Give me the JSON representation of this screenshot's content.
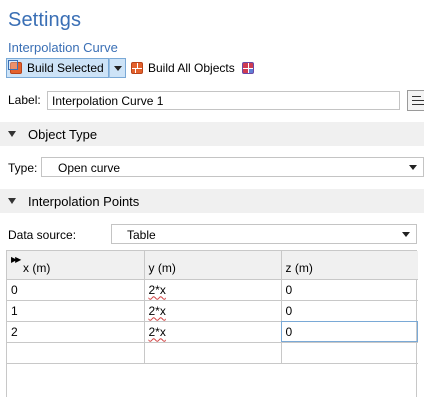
{
  "settings": {
    "title": "Settings",
    "subtitle": "Interpolation Curve"
  },
  "toolbar": {
    "build_selected_label": "Build Selected",
    "build_all_label": "Build All Objects"
  },
  "label_field": {
    "label": "Label:",
    "value": "Interpolation Curve 1"
  },
  "object_type": {
    "section_title": "Object Type",
    "type_label": "Type:",
    "type_value": "Open curve"
  },
  "interpolation_points": {
    "section_title": "Interpolation Points",
    "data_source_label": "Data source:",
    "data_source_value": "Table",
    "columns": [
      "x (m)",
      "y (m)",
      "z (m)"
    ],
    "rows": [
      [
        "0",
        "2*x",
        "0"
      ],
      [
        "1",
        "2*x",
        "0"
      ],
      [
        "2",
        "2*x",
        "0"
      ],
      [
        "",
        "",
        ""
      ]
    ]
  },
  "colors": {
    "accent": "#3a6fb5",
    "section_bg": "#f0f0f0",
    "button_highlight": "#cde3f7"
  },
  "icons": {
    "build_selected": "build-selected-icon",
    "build_all": "build-all-icon",
    "build_all_secondary": "build-all-secondary-icon",
    "label_button": "label-options-icon",
    "table_corner": "table-corner-icon"
  }
}
